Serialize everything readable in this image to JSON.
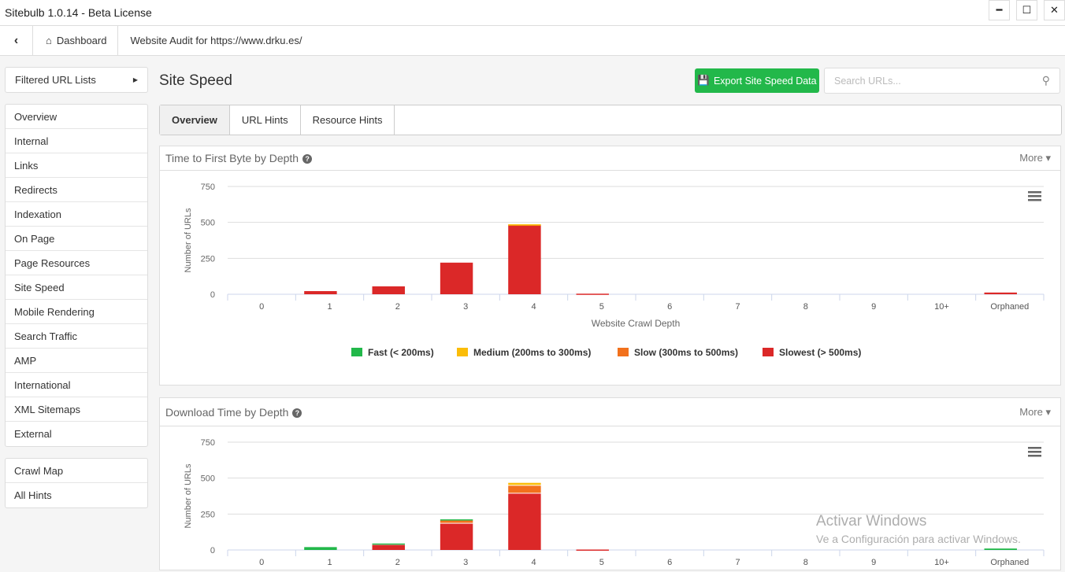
{
  "window": {
    "title": "Sitebulb 1.0.14  - Beta License",
    "minimize": "━",
    "maximize": "☐",
    "close": "✕"
  },
  "nav": {
    "back": "‹",
    "dashboard": "Dashboard",
    "audit": "Website Audit for https://www.drku.es/"
  },
  "sidebar": {
    "filtered": "Filtered URL Lists",
    "items": [
      "Overview",
      "Internal",
      "Links",
      "Redirects",
      "Indexation",
      "On Page",
      "Page Resources",
      "Site Speed",
      "Mobile Rendering",
      "Search Traffic",
      "AMP",
      "International",
      "XML Sitemaps",
      "External"
    ],
    "items2": [
      "Crawl Map",
      "All Hints"
    ]
  },
  "page": {
    "title": "Site Speed",
    "export": "Export Site Speed Data",
    "search_placeholder": "Search URLs..."
  },
  "tabs": [
    "Overview",
    "URL Hints",
    "Resource Hints"
  ],
  "colors": {
    "fast": "#22b84a",
    "medium": "#fbbd08",
    "slow": "#f2711c",
    "slowest": "#db2828",
    "accent": "#22b84a"
  },
  "watermark": {
    "line1": "Activar Windows",
    "line2": "Ve a Configuración para activar Windows."
  },
  "chart_data": [
    {
      "type": "bar",
      "stacked": true,
      "title": "Time to First Byte by Depth",
      "more": "More",
      "xlabel": "Website Crawl Depth",
      "ylabel": "Number of URLs",
      "ylim": [
        0,
        750
      ],
      "yticks": [
        "0",
        "250",
        "500",
        "750"
      ],
      "categories": [
        "0",
        "1",
        "2",
        "3",
        "4",
        "5",
        "6",
        "7",
        "8",
        "9",
        "10+",
        "Orphaned"
      ],
      "legend_position": "bottom",
      "grid": true,
      "series": [
        {
          "name": "Fast (< 200ms)",
          "color": "#22b84a",
          "values": [
            0,
            0,
            0,
            0,
            0,
            0,
            0,
            0,
            0,
            0,
            0,
            0
          ]
        },
        {
          "name": "Medium (200ms to 300ms)",
          "color": "#fbbd08",
          "values": [
            0,
            0,
            0,
            0,
            3,
            0,
            0,
            0,
            0,
            0,
            0,
            0
          ]
        },
        {
          "name": "Slow (300ms to 500ms)",
          "color": "#f2711c",
          "values": [
            0,
            0,
            0,
            0,
            6,
            0,
            0,
            0,
            0,
            0,
            0,
            0
          ]
        },
        {
          "name": "Slowest (> 500ms)",
          "color": "#db2828",
          "values": [
            0,
            22,
            55,
            220,
            478,
            4,
            0,
            0,
            0,
            0,
            0,
            12
          ]
        }
      ]
    },
    {
      "type": "bar",
      "stacked": true,
      "title": "Download Time by Depth",
      "more": "More",
      "ylabel": "Number of URLs",
      "ylim": [
        0,
        750
      ],
      "yticks": [
        "0",
        "250",
        "500",
        "750"
      ],
      "categories": [
        "0",
        "1",
        "2",
        "3",
        "4",
        "5",
        "6",
        "7",
        "8",
        "9",
        "10+",
        "Orphaned"
      ],
      "grid": true,
      "series": [
        {
          "name": "Fast (< 200ms)",
          "color": "#22b84a",
          "values": [
            0,
            20,
            10,
            8,
            0,
            0,
            0,
            0,
            0,
            0,
            0,
            10
          ]
        },
        {
          "name": "Medium (200ms to 300ms)",
          "color": "#fbbd08",
          "values": [
            0,
            0,
            0,
            0,
            20,
            0,
            0,
            0,
            0,
            0,
            0,
            0
          ]
        },
        {
          "name": "Slow (300ms to 500ms)",
          "color": "#f2711c",
          "values": [
            0,
            0,
            0,
            22,
            55,
            0,
            0,
            0,
            0,
            0,
            0,
            0
          ]
        },
        {
          "name": "Slowest (> 500ms)",
          "color": "#db2828",
          "values": [
            0,
            0,
            35,
            183,
            392,
            3,
            0,
            0,
            0,
            0,
            0,
            0
          ]
        }
      ]
    }
  ]
}
